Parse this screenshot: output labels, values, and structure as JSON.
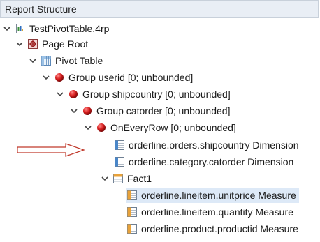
{
  "panel": {
    "title": "Report Structure"
  },
  "tree": {
    "file": "TestPivotTable.4rp",
    "page_root": "Page Root",
    "pivot_table": "Pivot Table",
    "group_userid": "Group userid [0; unbounded]",
    "group_shipcountry": "Group shipcountry [0; unbounded]",
    "group_catorder": "Group catorder [0; unbounded]",
    "on_every_row": "OnEveryRow [0; unbounded]",
    "dim_shipcountry": "orderline.orders.shipcountry Dimension",
    "dim_catorder": "orderline.category.catorder Dimension",
    "fact": "Fact1",
    "measure_unitprice": "orderline.lineitem.unitprice Measure",
    "measure_quantity": "orderline.lineitem.quantity Measure",
    "measure_productid": "orderline.product.productid Measure"
  },
  "icons": {
    "file": "report-file-icon",
    "page_root": "page-root-icon",
    "pivot": "pivot-table-icon",
    "group": "red-ball-icon",
    "dimension": "dimension-icon",
    "fact": "fact-icon",
    "measure": "measure-icon"
  },
  "colors": {
    "header_bg": "#e9eef5",
    "selection_bg": "#dde9f7",
    "group_ball": "#d81f1f",
    "arrow": "#c0392b"
  }
}
